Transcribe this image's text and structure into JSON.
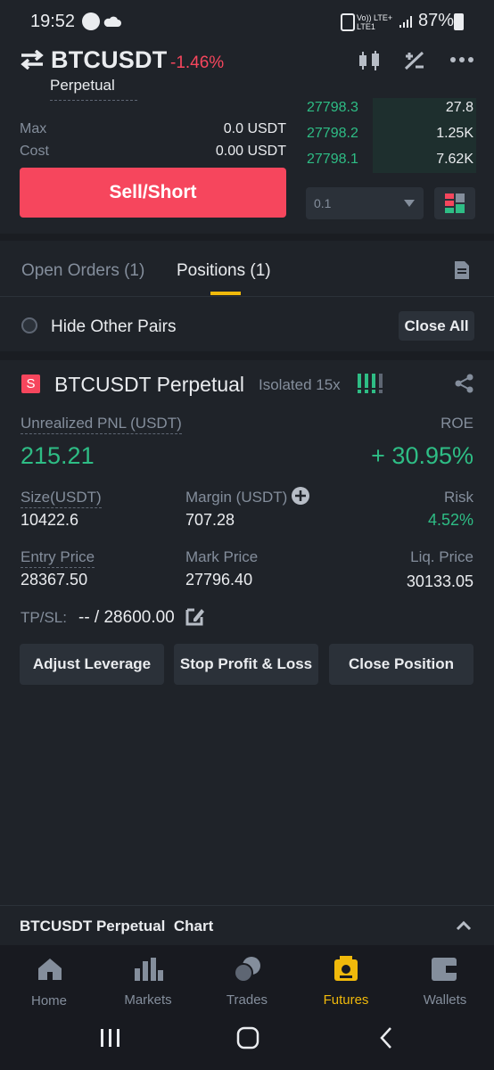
{
  "status_bar": {
    "time": "19:52",
    "network": "Vo)) LTE+ LTE1",
    "battery": "87%"
  },
  "header": {
    "pair": "BTCUSDT",
    "change": "-1.46%",
    "contract_type": "Perpetual"
  },
  "order_form": {
    "max_label": "Max",
    "max_value": "0.0 USDT",
    "cost_label": "Cost",
    "cost_value": "0.00 USDT",
    "sell_button": "Sell/Short"
  },
  "order_book": {
    "rows": [
      {
        "price": "27798.3",
        "amount": "27.8"
      },
      {
        "price": "27798.2",
        "amount": "1.25K"
      },
      {
        "price": "27798.1",
        "amount": "7.62K"
      }
    ],
    "precision": "0.1"
  },
  "tabs": {
    "open_orders": "Open Orders (1)",
    "positions": "Positions (1)"
  },
  "filter": {
    "hide_other_pairs": "Hide Other Pairs",
    "close_all": "Close All"
  },
  "position": {
    "side_badge": "S",
    "symbol": "BTCUSDT Perpetual",
    "margin_mode": "Isolated 15x",
    "pnl_label": "Unrealized PNL (USDT)",
    "pnl_value": "215.21",
    "roe_label": "ROE",
    "roe_value": "+ 30.95%",
    "size_label": "Size(USDT)",
    "size_value": "10422.6",
    "margin_label": "Margin (USDT)",
    "margin_value": "707.28",
    "risk_label": "Risk",
    "risk_value": "4.52%",
    "entry_label": "Entry Price",
    "entry_value": "28367.50",
    "mark_label": "Mark Price",
    "mark_value": "27796.40",
    "liq_label": "Liq. Price",
    "liq_value": "30133.05",
    "tpsl_label": "TP/SL:",
    "tpsl_value": "-- / 28600.00",
    "adjust_leverage": "Adjust Leverage",
    "stop_profit_loss": "Stop Profit & Loss",
    "close_position": "Close Position"
  },
  "chart_bar": {
    "label": "BTCUSDT Perpetual  Chart"
  },
  "bottom_nav": {
    "items": [
      {
        "label": "Home",
        "icon": "home-icon"
      },
      {
        "label": "Markets",
        "icon": "markets-icon"
      },
      {
        "label": "Trades",
        "icon": "trades-icon"
      },
      {
        "label": "Futures",
        "icon": "futures-icon",
        "active": true
      },
      {
        "label": "Wallets",
        "icon": "wallet-icon"
      }
    ]
  },
  "colors": {
    "background": "#1f2329",
    "red": "#f6465d",
    "green": "#2ebd85",
    "accent": "#f0b90b"
  }
}
